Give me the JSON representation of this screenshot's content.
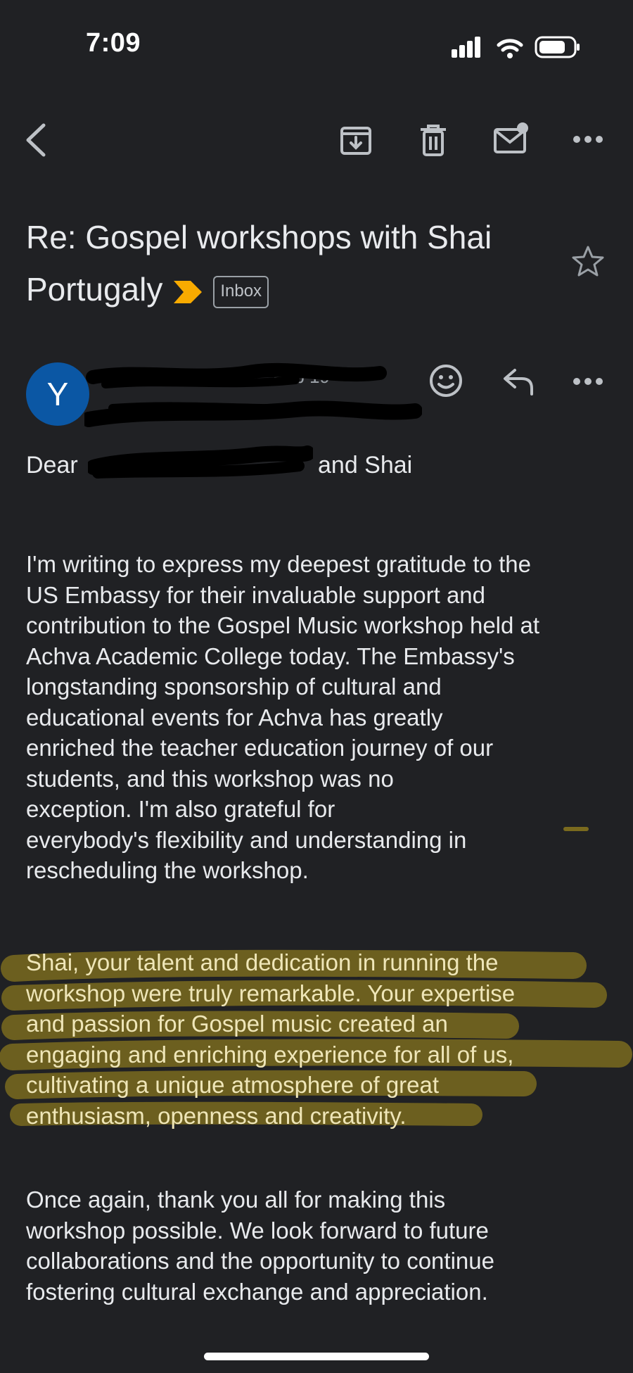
{
  "status_bar": {
    "time": "7:09"
  },
  "toolbar": {
    "back": "back-icon",
    "archive": "archive-icon",
    "delete": "trash-icon",
    "mark_unread": "mail-unread-icon",
    "more": "more-icon"
  },
  "email": {
    "subject": "Re: Gospel workshops with Shai Portugaly",
    "label": "Inbox",
    "importance_color": "#f9ab00",
    "sender": {
      "initial": "Y",
      "avatar_color": "#0b57a4",
      "date": "Feb 19"
    },
    "greeting_prefix": "Dear",
    "greeting_suffix": "and Shai",
    "paragraphs": [
      "I'm writing to express my deepest gratitude to the\nUS Embassy for their invaluable support and\ncontribution to the Gospel Music workshop held at\nAchva Academic College today. The Embassy's\nlongstanding sponsorship of cultural and\neducational events for Achva has greatly\nenriched the teacher education journey of our\nstudents, and this workshop was no\nexception. I'm also grateful for\neverybody's flexibility and understanding in\nrescheduling the workshop.",
      "Shai, your talent and dedication in running the\nworkshop were truly remarkable. Your expertise\nand passion for Gospel music created an\nengaging and enriching experience for all of us,\ncultivating a unique atmosphere of great\nenthusiasm, openness and creativity.",
      "Once again, thank you all for making this\nworkshop possible. We look forward to future\ncollaborations and the opportunity to continue\nfostering cultural exchange and appreciation."
    ]
  },
  "colors": {
    "background": "#202124",
    "text": "#e8eaed",
    "highlight": "#7a6a1e",
    "redaction": "#000000"
  }
}
